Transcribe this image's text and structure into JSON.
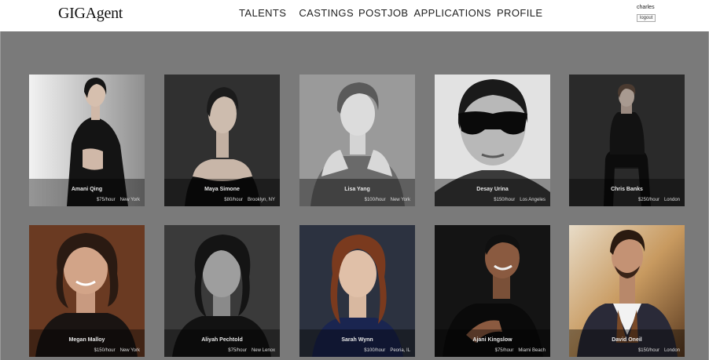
{
  "brand": {
    "logo": "GIGAgent"
  },
  "nav": {
    "items": [
      "TALENTS",
      "CASTINGS",
      "POSTJOB",
      "APPLICATIONS",
      "PROFILE"
    ]
  },
  "user": {
    "name": "charles",
    "logout_label": "logout"
  },
  "talents": [
    {
      "name": "Amani Qing",
      "rate": "$75/hour",
      "location": "New York",
      "icon": "portrait-photo"
    },
    {
      "name": "Maya Simone",
      "rate": "$80/hour",
      "location": "Brooklyn, NY",
      "icon": "portrait-photo"
    },
    {
      "name": "Lisa Yang",
      "rate": "$100/hour",
      "location": "New York",
      "icon": "portrait-photo"
    },
    {
      "name": "Desay Urina",
      "rate": "$150/hour",
      "location": "Los Angeles",
      "icon": "portrait-photo"
    },
    {
      "name": "Chris Banks",
      "rate": "$250/hour",
      "location": "London",
      "icon": "portrait-photo"
    },
    {
      "name": "Megan Malloy",
      "rate": "$150/hour",
      "location": "New York",
      "icon": "portrait-photo"
    },
    {
      "name": "Aliyah Pechtold",
      "rate": "$75/hour",
      "location": "New Lenox",
      "icon": "portrait-photo"
    },
    {
      "name": "Sarah Wynn",
      "rate": "$100/hour",
      "location": "Peoria, IL",
      "icon": "portrait-photo"
    },
    {
      "name": "Ajani Kingslow",
      "rate": "$75/hour",
      "location": "Miami Beach",
      "icon": "portrait-photo"
    },
    {
      "name": "David Oneil",
      "rate": "$150/hour",
      "location": "London",
      "icon": "portrait-photo"
    }
  ],
  "colors": {
    "page_background": "#7a7a7a",
    "navbar_background": "#ffffff",
    "card_overlay": "#000000"
  }
}
